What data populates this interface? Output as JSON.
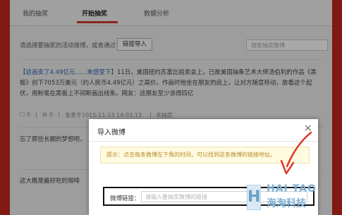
{
  "tabs": [
    {
      "label": "我的抽奖"
    },
    {
      "label": "开始抽奖"
    },
    {
      "label": "数据分析"
    }
  ],
  "toolbar": {
    "prompt_text": "请选择要抽奖的活动微博，或者通过",
    "import_button": "链接导入",
    "search_placeholder": "搜索抽奖微博"
  },
  "posts": [
    {
      "title_link": "【这画卖了4.49亿元……来感受下】",
      "body": "11日，美国纽约苏富比拍卖会上，已故美国抽象艺术大师汤伯利的作品《黑板》创下7053万美元（约人民币4.49亿元）之高价。作画时他坐在朋友的肩上，让对方随意移动，故看这个起伏，用粉笔在黑板上不间断画出线条。网友：这朋友至少该得四亿",
      "meta_comments": "0",
      "meta_reposts": "0",
      "meta_time": "发表于2015-11-13 14:03:13",
      "meta_status": "未抽奖"
    },
    {
      "body": "忘了那些长期的梦想吧，"
    },
    {
      "body": "这大概是最好吃的咖啡"
    }
  ],
  "dialog": {
    "title": "导入微博",
    "close_label": "×",
    "tip": "提示：点击每条微博左下角的时间，可以找到这条微博的链接地址。",
    "link_label": "微博链接：",
    "link_placeholder": "请输入要抽奖微博的链接"
  },
  "watermark": {
    "en": "HAI TAO",
    "cn": "海淘科技",
    "logo_letter": "H"
  },
  "colors": {
    "brand_red": "#c3281e",
    "link_blue": "#2c66b8",
    "tip_text": "#b58a27",
    "arrow": "#e03a2a"
  }
}
